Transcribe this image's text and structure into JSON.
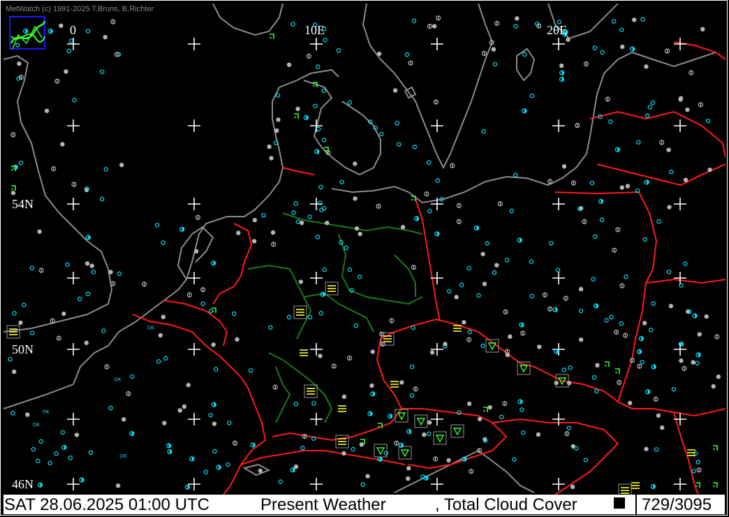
{
  "header": {
    "credit": "MetWatch  (c) 1991-2025 T.Bruns, B.Richter"
  },
  "grid_labels": {
    "lon_0": "0",
    "lon_10": "10E",
    "lon_20": "20E",
    "lat_54": "54N",
    "lat_50": "50N",
    "lat_46": "46N"
  },
  "status": {
    "datetime": "SAT 28.06.2025 01:00 UTC",
    "parameter": "Present Weather",
    "parameter2": ", Total Cloud Cover",
    "count": "729/3095"
  },
  "colors": {
    "background": "#000000",
    "coastline": "#8c8c8c",
    "border_country": "#ff1a1a",
    "border_state": "#1a7a1a",
    "station_cyan": "#00e5ff",
    "station_gray": "#b4b4b4",
    "weather_green": "#33ff33",
    "weather_yellow": "#ffff33",
    "grid_cross": "#ffffff"
  },
  "icons": {
    "logo": "metwatch-logo-icon",
    "cross": "grid-cross-icon",
    "clear": "clear-sky-circle-icon",
    "half": "half-cloud-circle-icon",
    "overcast": "overcast-dot-icon",
    "ok": "ok-label-icon",
    "fog": "fog-lines-icon",
    "shower": "shower-triangle-icon"
  },
  "station_label_ok": "OK"
}
